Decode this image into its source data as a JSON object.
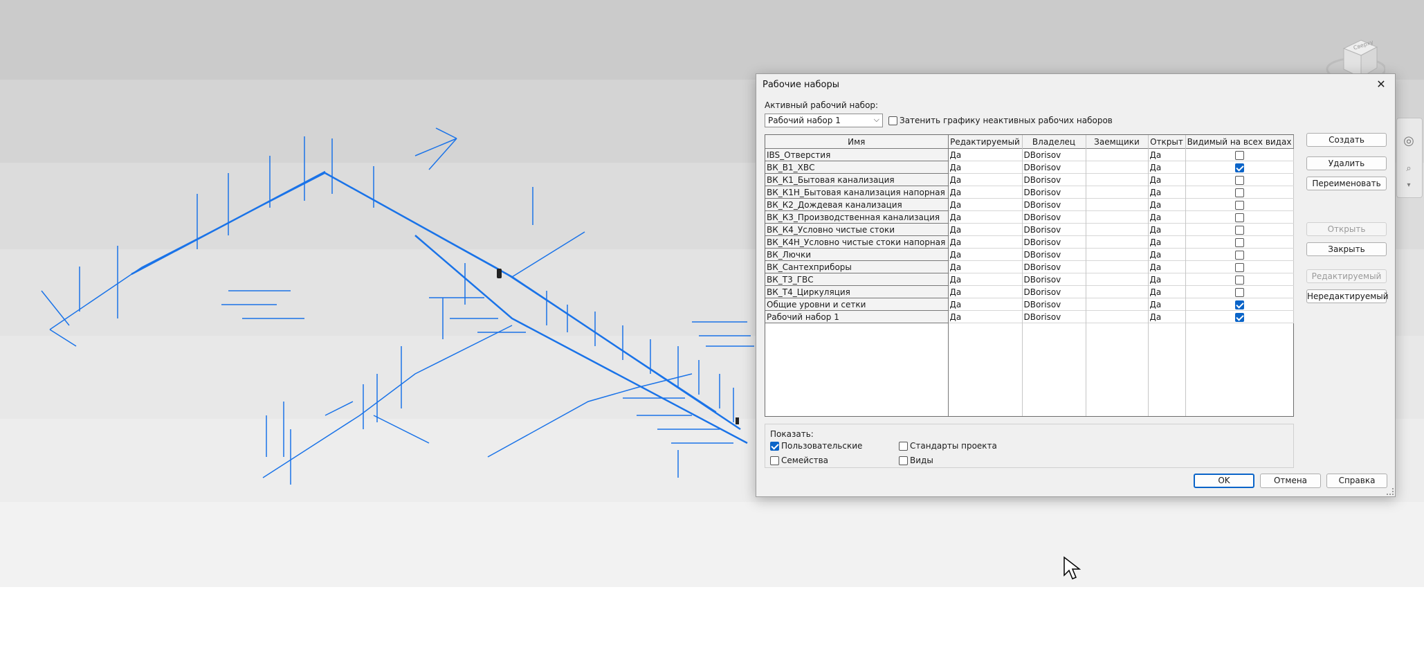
{
  "dialog": {
    "title": "Рабочие наборы",
    "active_label": "Активный рабочий набор:",
    "active_value": "Рабочий набор 1",
    "dim_label": "Затенить графику неактивных рабочих наборов",
    "dim_checked": false
  },
  "table": {
    "columns": [
      "Имя",
      "Редактируемый",
      "Владелец",
      "Заемщики",
      "Открыт",
      "Видимый на всех видах"
    ],
    "rows": [
      {
        "name": "IBS_Отверстия",
        "editable": "Да",
        "owner": "DBorisov",
        "borrowers": "",
        "open": "Да",
        "visible": false
      },
      {
        "name": "ВК_В1_ХВС",
        "editable": "Да",
        "owner": "DBorisov",
        "borrowers": "",
        "open": "Да",
        "visible": true
      },
      {
        "name": "ВК_К1_Бытовая канализация",
        "editable": "Да",
        "owner": "DBorisov",
        "borrowers": "",
        "open": "Да",
        "visible": false
      },
      {
        "name": "ВК_К1Н_Бытовая канализация напорная",
        "editable": "Да",
        "owner": "DBorisov",
        "borrowers": "",
        "open": "Да",
        "visible": false
      },
      {
        "name": "ВК_К2_Дождевая канализация",
        "editable": "Да",
        "owner": "DBorisov",
        "borrowers": "",
        "open": "Да",
        "visible": false
      },
      {
        "name": "ВК_К3_Производственная канализация",
        "editable": "Да",
        "owner": "DBorisov",
        "borrowers": "",
        "open": "Да",
        "visible": false
      },
      {
        "name": "ВК_К4_Условно чистые стоки",
        "editable": "Да",
        "owner": "DBorisov",
        "borrowers": "",
        "open": "Да",
        "visible": false
      },
      {
        "name": "ВК_К4Н_Условно чистые стоки напорная",
        "editable": "Да",
        "owner": "DBorisov",
        "borrowers": "",
        "open": "Да",
        "visible": false
      },
      {
        "name": "ВК_Лючки",
        "editable": "Да",
        "owner": "DBorisov",
        "borrowers": "",
        "open": "Да",
        "visible": false
      },
      {
        "name": "ВК_Сантехприборы",
        "editable": "Да",
        "owner": "DBorisov",
        "borrowers": "",
        "open": "Да",
        "visible": false
      },
      {
        "name": "ВК_Т3_ГВС",
        "editable": "Да",
        "owner": "DBorisov",
        "borrowers": "",
        "open": "Да",
        "visible": false
      },
      {
        "name": "ВК_Т4_Циркуляция",
        "editable": "Да",
        "owner": "DBorisov",
        "borrowers": "",
        "open": "Да",
        "visible": false
      },
      {
        "name": "Общие уровни и сетки",
        "editable": "Да",
        "owner": "DBorisov",
        "borrowers": "",
        "open": "Да",
        "visible": true
      },
      {
        "name": "Рабочий набор 1",
        "editable": "Да",
        "owner": "DBorisov",
        "borrowers": "",
        "open": "Да",
        "visible": true
      }
    ]
  },
  "side_buttons": {
    "create": "Создать",
    "delete": "Удалить",
    "rename": "Переименовать",
    "open": "Открыть",
    "close": "Закрыть",
    "editable": "Редактируемый",
    "noneditable": "Нередактируемый"
  },
  "show": {
    "label": "Показать:",
    "user": "Пользовательские",
    "user_checked": true,
    "standards": "Стандарты проекта",
    "standards_checked": false,
    "families": "Семейства",
    "families_checked": false,
    "views": "Виды",
    "views_checked": false
  },
  "footer": {
    "ok": "OK",
    "cancel": "Отмена",
    "help": "Справка"
  },
  "viewcube": {
    "face_label": "Сверху"
  },
  "colors": {
    "pipe": "#1a73e8",
    "accent": "#0a64c8"
  }
}
